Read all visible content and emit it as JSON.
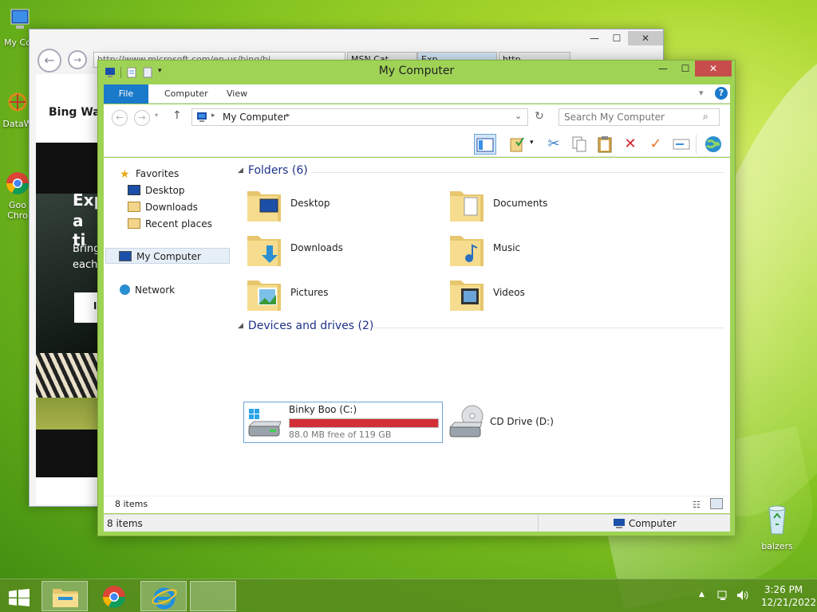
{
  "desktop": {
    "icons": [
      {
        "label": "My Co"
      },
      {
        "label": "DataW"
      },
      {
        "label": "Goo Chro"
      },
      {
        "label": "balzers"
      }
    ]
  },
  "ie": {
    "address": "http://www.microsoft.com/en-us/bing/bi",
    "tabs": [
      "MSN Cat",
      "Exp",
      "http..."
    ],
    "page_heading": "Bing Wal",
    "hero_line1": "Exp",
    "hero_line2": "a ti",
    "hero_body1": "Bring",
    "hero_body2": "each",
    "hero_btn": "I"
  },
  "explorer": {
    "title": "My Computer",
    "ribbon_tabs": [
      "File",
      "Computer",
      "View"
    ],
    "address_path": "My Computer",
    "search_placeholder": "Search My Computer",
    "nav": {
      "favorites": "Favorites",
      "favorites_items": [
        "Desktop",
        "Downloads",
        "Recent places"
      ],
      "my_computer": "My Computer",
      "network": "Network"
    },
    "folders_header": "Folders (6)",
    "folders": [
      {
        "name": "Desktop"
      },
      {
        "name": "Documents"
      },
      {
        "name": "Downloads"
      },
      {
        "name": "Music"
      },
      {
        "name": "Pictures"
      },
      {
        "name": "Videos"
      }
    ],
    "devices_header": "Devices and drives (2)",
    "drive_c": {
      "name": "Binky Boo (C:)",
      "free": "88.0 MB free of 119 GB",
      "used_fraction": 0.999
    },
    "drive_d": {
      "name": "CD Drive (D:)"
    },
    "status_items": "8 items",
    "status_items2": "8 items",
    "status_location": "Computer"
  },
  "taskbar": {
    "time": "3:26 PM",
    "date": "12/21/2022"
  },
  "colors": {
    "accent": "#1979ca",
    "frame": "#9fd356",
    "drive_bar": "#d32f36",
    "group_head": "#1e3287"
  }
}
